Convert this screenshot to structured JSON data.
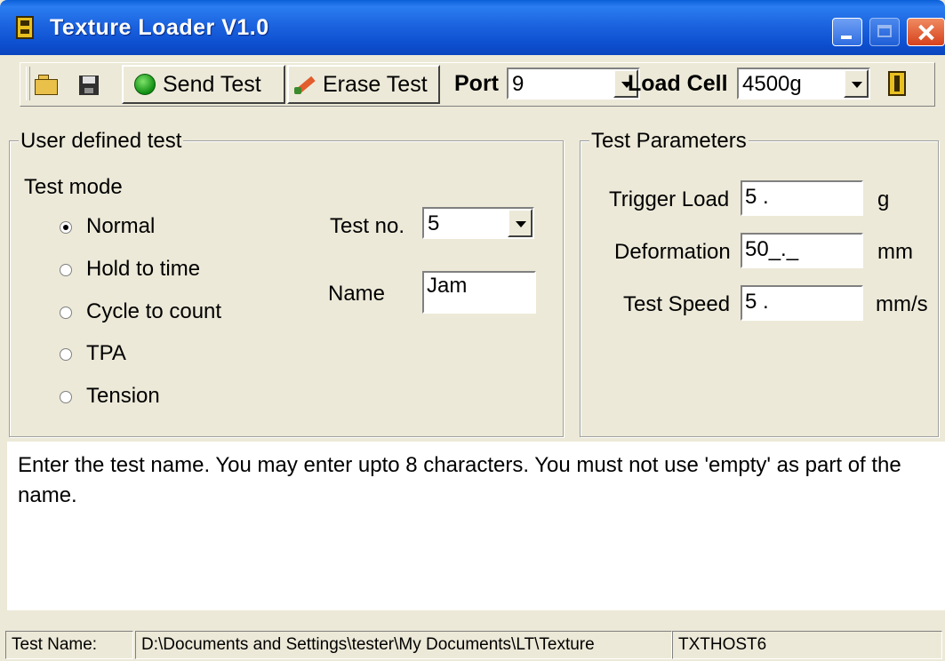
{
  "window": {
    "title": "Texture Loader V1.0"
  },
  "toolbar": {
    "send_label": "Send Test",
    "erase_label": "Erase Test",
    "port_label": "Port",
    "port_value": "9",
    "load_cell_label": "Load Cell",
    "load_cell_value": "4500g"
  },
  "user_test": {
    "group_title": "User defined test",
    "mode_label": "Test mode",
    "modes": [
      {
        "label": "Normal",
        "selected": true
      },
      {
        "label": "Hold to time",
        "selected": false
      },
      {
        "label": "Cycle to count",
        "selected": false
      },
      {
        "label": "TPA",
        "selected": false
      },
      {
        "label": "Tension",
        "selected": false
      }
    ],
    "test_no_label": "Test no.",
    "test_no_value": "5",
    "name_label": "Name",
    "name_value": "Jam"
  },
  "params": {
    "group_title": "Test Parameters",
    "trigger_label": "Trigger Load",
    "trigger_value": "5  .",
    "trigger_unit": "g",
    "deformation_label": "Deformation",
    "deformation_value": "50_._",
    "deformation_unit": "mm",
    "speed_label": "Test Speed",
    "speed_value": "5 .",
    "speed_unit": "mm/s"
  },
  "help_text": "Enter the test name. You may enter upto 8 characters. You must not use 'empty' as part of the name.",
  "status": {
    "test_name": "Test Name:",
    "path": "D:\\Documents and Settings\\tester\\My Documents\\LT\\Texture",
    "host": "TXTHOST6"
  }
}
